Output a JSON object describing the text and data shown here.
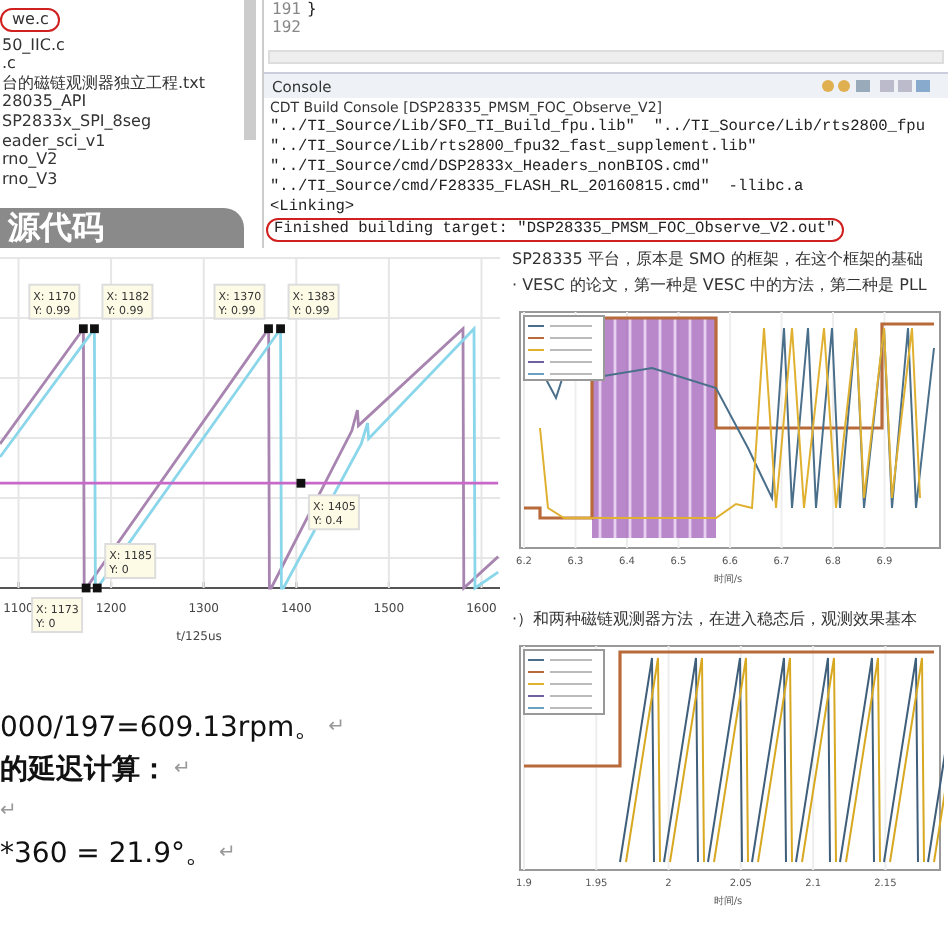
{
  "explorer": {
    "items": [
      {
        "label": "we.c",
        "circled": true
      },
      {
        "label": "50_IIC.c",
        "circled": false
      },
      {
        "label": ".c",
        "circled": false
      },
      {
        "label": "台的磁链观测器独立工程.txt",
        "circled": false
      },
      {
        "label": "28035_API",
        "circled": false
      },
      {
        "label": "SP2833x_SPI_8seg",
        "circled": false
      },
      {
        "label": "eader_sci_v1",
        "circled": false
      },
      {
        "label": "rno_V2",
        "circled": false
      },
      {
        "label": "rno_V3",
        "circled": false
      }
    ],
    "banner": "源代码"
  },
  "editor": {
    "lines": [
      {
        "number": "191",
        "code": "}"
      },
      {
        "number": "192"
      }
    ]
  },
  "console": {
    "tab": "Console",
    "title": "CDT Build Console [DSP28335_PMSM_FOC_Observe_V2]",
    "lines": [
      {
        "text": "\"../TI_Source/Lib/SFO_TI_Build_fpu.lib\"  \"../TI_Source/Lib/rts2800_fpu",
        "circled": false
      },
      {
        "text": "\"../TI_Source/Lib/rts2800_fpu32_fast_supplement.lib\"",
        "circled": false
      },
      {
        "text": "\"../TI_Source/cmd/DSP2833x_Headers_nonBIOS.cmd\"",
        "circled": false
      },
      {
        "text": "\"../TI_Source/cmd/F28335_FLASH_RL_20160815.cmd\"  -llibc.a",
        "circled": false
      },
      {
        "text": "<Linking>",
        "circled": false
      },
      {
        "text": "Finished building target: \"DSP28335_PMSM_FOC_Observe_V2.out\"",
        "circled": true
      }
    ]
  },
  "plot": {
    "xlabel": "t/125us",
    "x_tick_labels": [
      "1100",
      "1200",
      "1300",
      "1400",
      "1500",
      "1600"
    ],
    "data_tips": [
      {
        "lines": [
          "X: 1170",
          "Y: 0.99"
        ]
      },
      {
        "lines": [
          "X: 1182",
          "Y: 0.99"
        ]
      },
      {
        "lines": [
          "X: 1370",
          "Y: 0.99"
        ]
      },
      {
        "lines": [
          "X: 1383",
          "Y: 0.99"
        ]
      },
      {
        "lines": [
          "X: 1405",
          "Y: 0.4"
        ]
      },
      {
        "lines": [
          "X: 1185",
          "Y: 0"
        ]
      },
      {
        "lines": [
          "X: 1173",
          "Y: 0"
        ]
      }
    ]
  },
  "document": {
    "paragraphs": [
      {
        "text": "000/197=609.13rpm。",
        "bold": false,
        "mark": "↵"
      },
      {
        "text": "的延迟计算：",
        "bold": true,
        "mark": "↵"
      },
      {
        "mark": "↵"
      },
      {
        "text": "*360 = 21.9°。",
        "bold": false,
        "mark": "↵"
      }
    ]
  },
  "article": {
    "intro": [
      "SP28335 平台，原本是 SMO 的框架，在这个框架的基础",
      "· VESC 的论文，第一种是 VESC 中的方法，第二种是 PLL"
    ],
    "chart_1": {
      "xlabel": "时间/s",
      "x_tick_labels": [
        "6.2",
        "6.3",
        "6.4",
        "6.5",
        "6.6",
        "6.7",
        "6.8",
        "6.9"
      ]
    },
    "middle": "·）和两种磁链观测器方法，在进入稳态后，观测效果基本",
    "chart_2": {
      "xlabel": "时间/s",
      "x_tick_labels": [
        "1.9",
        "1.95",
        "2",
        "2.05",
        "2.1",
        "2.15"
      ]
    }
  }
}
